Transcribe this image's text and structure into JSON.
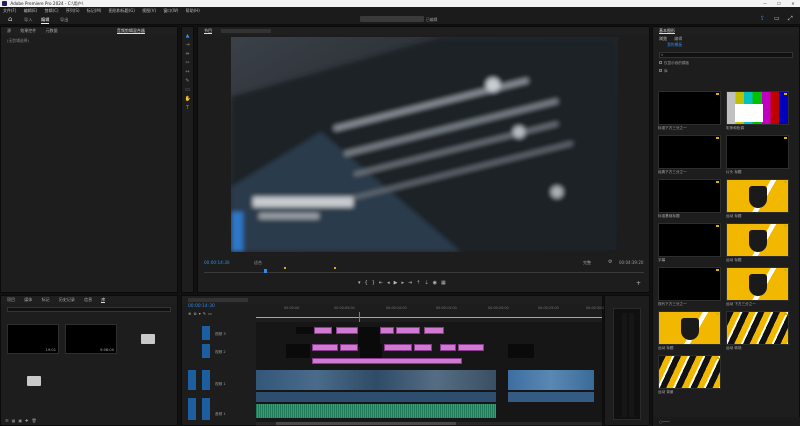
{
  "app": {
    "title": "Adobe Premiere Pro 2024 - C:\\用户\\",
    "window_controls": [
      "—",
      "☐",
      "✕"
    ]
  },
  "menu": [
    "文件(F)",
    "编辑(E)",
    "剪辑(C)",
    "序列(S)",
    "标记(M)",
    "图形和标题(G)",
    "视图(V)",
    "窗口(W)",
    "帮助(H)"
  ],
  "topbar": {
    "tabs": [
      "导入",
      "编辑",
      "导出"
    ],
    "active_tab": "编辑",
    "center_title": "已编辑"
  },
  "source_panel": {
    "tabs": [
      "源",
      "效果控件",
      "元数据",
      "音频剪辑混合器"
    ],
    "active_tab": "音频剪辑混合器",
    "empty_text": "(无剪辑选择)"
  },
  "program_monitor": {
    "tab": "节目",
    "timecode_left": "00:00:14:30",
    "fit_label": "适合",
    "quality_label": "完整",
    "timecode_right": "00:04:39:20"
  },
  "project_panel": {
    "tabs": [
      "项目",
      "媒体",
      "标记",
      "历史记录",
      "信息",
      "库"
    ],
    "active_tab": "信息",
    "items": [
      {
        "label": "",
        "duration": "19:01"
      },
      {
        "label": "",
        "duration": "9:08:00"
      },
      {
        "label": "",
        "duration": ""
      },
      {
        "label": "",
        "duration": ""
      }
    ]
  },
  "timeline": {
    "timecode": "00:00:14:30",
    "tracks": [
      {
        "id": "V3",
        "label": "视频 3"
      },
      {
        "id": "V2",
        "label": "视频 2"
      },
      {
        "id": "V1",
        "label": "视频 1"
      },
      {
        "id": "A1",
        "label": "音频 1"
      },
      {
        "id": "A2",
        "label": "音频 2"
      }
    ],
    "ruler_ticks": [
      "00:00:00",
      "00:00:05:00",
      "00:00:10:00",
      "00:00:15:00",
      "00:00:20:00",
      "00:00:25:00",
      "00:00:30:00"
    ]
  },
  "essential_graphics": {
    "title": "基本图形",
    "tabs": [
      "浏览",
      "编辑"
    ],
    "active_tab": "浏览",
    "subtab": "我的模板",
    "search_placeholder": "",
    "options": [
      "仅显示我的模板",
      "库"
    ],
    "templates": [
      {
        "name": "标准下方三分之一",
        "style": "dark"
      },
      {
        "name": "彩条和色调",
        "style": "bars"
      },
      {
        "name": "经典下方三分之一",
        "style": "dark"
      },
      {
        "name": "片头 标题",
        "style": "dark"
      },
      {
        "name": "标准基础标题",
        "style": "dark"
      },
      {
        "name": "运动 标题",
        "style": "gold"
      },
      {
        "name": "字幕",
        "style": "dark"
      },
      {
        "name": "运动 标题",
        "style": "gold"
      },
      {
        "name": "现代下方三分之一",
        "style": "dark"
      },
      {
        "name": "运动 下方三分之一",
        "style": "gold"
      },
      {
        "name": "运动 标题",
        "style": "gold"
      },
      {
        "name": "运动 转场",
        "style": "stripe"
      },
      {
        "name": "运动 背景",
        "style": "stripe"
      }
    ]
  },
  "colors": {
    "accent_blue": "#2d8ceb",
    "playhead": "#2d8ceb",
    "clip_pink": "#d07ad3",
    "audio_green": "#1f7a58",
    "gold": "#f2b800"
  }
}
